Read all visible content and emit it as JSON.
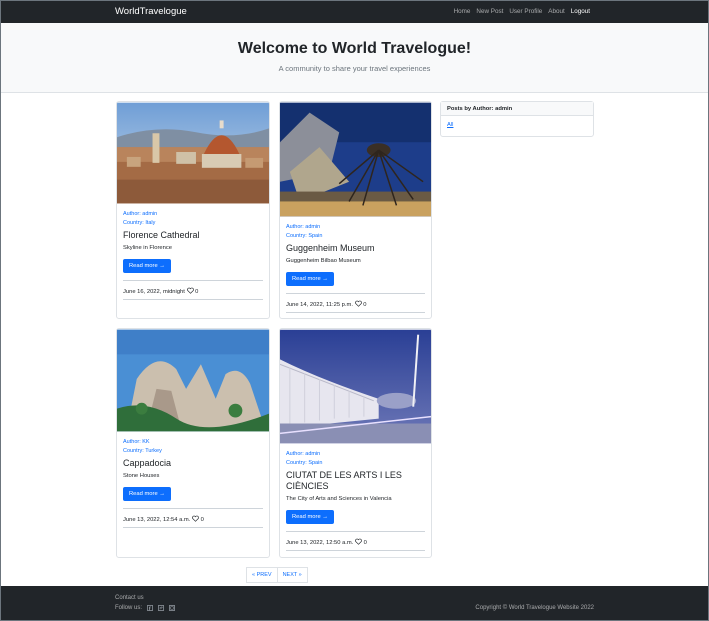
{
  "nav": {
    "brand": "WorldTravelogue",
    "links": [
      "Home",
      "New Post",
      "User Profile",
      "About",
      "Logout"
    ]
  },
  "hero": {
    "title": "Welcome to World Travelogue!",
    "subtitle": "A community to share your travel experiences"
  },
  "posts": [
    {
      "author": "Author: admin",
      "country": "Country: Italy",
      "title": "Florence Cathedral",
      "text": "Skyline in Florence",
      "button": "Read more →",
      "date": "June 16, 2022, midnight",
      "likes": "0"
    },
    {
      "author": "Author: admin",
      "country": "Country: Spain",
      "title": "Guggenheim Museum",
      "text": "Guggenheim Bilbao Museum",
      "button": "Read more →",
      "date": "June 14, 2022, 11:25 p.m.",
      "likes": "0"
    },
    {
      "author": "Author: KK",
      "country": "Country: Turkey",
      "title": "Cappadocia",
      "text": "Stone Houses",
      "button": "Read more →",
      "date": "June 13, 2022, 12:54 a.m.",
      "likes": "0"
    },
    {
      "author": "Author: admin",
      "country": "Country: Spain",
      "title": "CIUTAT DE LES ARTS I LES CIÈNCIES",
      "text": "The City of Arts and Sciences in Valencia",
      "button": "Read more →",
      "date": "June 13, 2022, 12:50 a.m.",
      "likes": "0"
    }
  ],
  "sidebar": {
    "heading": "Posts by Author: admin",
    "link": "All"
  },
  "pagination": {
    "prev": "« PREV",
    "next": "NEXT »"
  },
  "footer": {
    "contact": "Contact us",
    "follow": "Follow us:",
    "social_icons": [
      "facebook-icon",
      "twitter-icon",
      "youtube-icon"
    ],
    "copyright": "Copyright © World Travelogue Website 2022"
  }
}
